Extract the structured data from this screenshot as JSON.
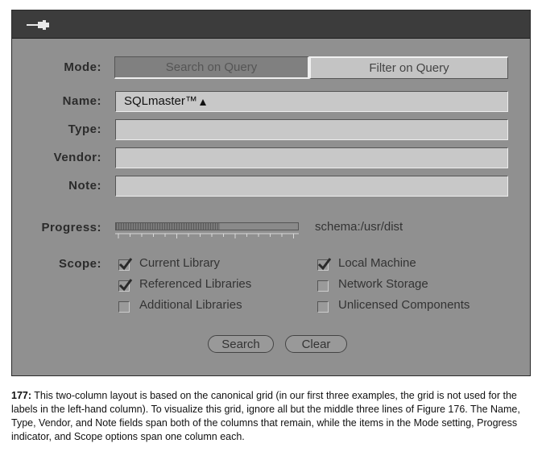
{
  "labels": {
    "mode": "Mode:",
    "name": "Name:",
    "type": "Type:",
    "vendor": "Vendor:",
    "note": "Note:",
    "progress": "Progress:",
    "scope": "Scope:"
  },
  "mode": {
    "options": [
      "Search on Query",
      "Filter on Query"
    ],
    "selected": "Search on Query"
  },
  "fields": {
    "name": "SQLmaster™",
    "type": "",
    "vendor": "",
    "note": ""
  },
  "progress": {
    "fraction": 0.57,
    "path": "schema:/usr/dist"
  },
  "scope": {
    "current_library": {
      "label": "Current Library",
      "checked": true
    },
    "referenced_libraries": {
      "label": "Referenced Libraries",
      "checked": true
    },
    "additional_libraries": {
      "label": "Additional Libraries",
      "checked": false
    },
    "local_machine": {
      "label": "Local Machine",
      "checked": true
    },
    "network_storage": {
      "label": "Network Storage",
      "checked": false
    },
    "unlicensed_components": {
      "label": "Unlicensed Components",
      "checked": false
    }
  },
  "buttons": {
    "search": "Search",
    "clear": "Clear"
  },
  "caption": {
    "number": "177:",
    "text": " This two-column layout is based on the canonical grid (in our first three examples, the grid is not used for the labels in the left-hand column). To visualize this grid, ignore all but the middle three lines of Figure 176. The Name, Type, Vendor, and Note fields span both of the columns that remain, while the items in the Mode setting, Progress indicator, and Scope options span one column each."
  }
}
